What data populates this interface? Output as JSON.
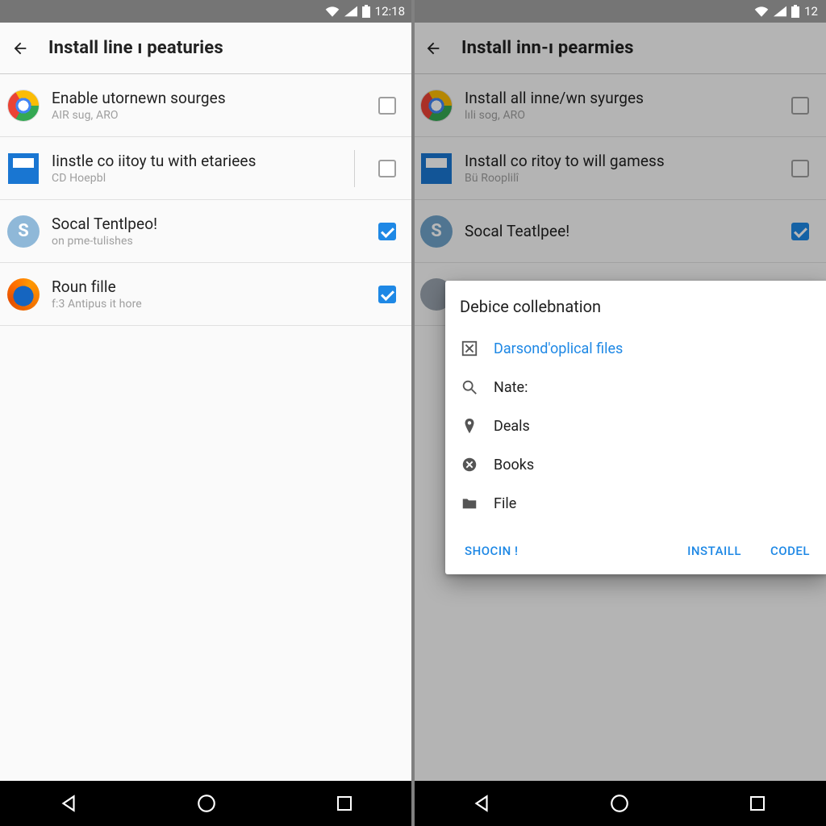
{
  "status": {
    "time": "12:18",
    "time_right_cut": "12"
  },
  "left": {
    "title": "Install line ı peaturies",
    "rows": [
      {
        "icon": "chrome-icon",
        "label": "Enable utornewn sourges",
        "sub": "AIR sug, ARO",
        "checked": false
      },
      {
        "icon": "box-icon",
        "label": "Iinstle co iitoy tu with etariees",
        "sub": "CD Hoepbl",
        "checked": false,
        "vdiv": true
      },
      {
        "icon": "skype-icon",
        "label": "Socal Tentlpeo!",
        "sub": "on pme-tulishes",
        "checked": true
      },
      {
        "icon": "firefox-icon",
        "label": "Roun fille",
        "sub": "f:3 Antipus it hore",
        "checked": true
      }
    ]
  },
  "right": {
    "title": "Install inn-ı pearmies",
    "rows": [
      {
        "icon": "chrome-icon",
        "label": "Install all inne/wn syurges",
        "sub": "lıli sog, ARO",
        "checked": false
      },
      {
        "icon": "box-icon",
        "label": "Install co ritoy to will gamess",
        "sub": "Bü Rooplilî",
        "checked": false
      },
      {
        "icon": "skype-icon",
        "label": "Socal Teatlpee!",
        "sub": "",
        "checked": true
      },
      {
        "icon": "circle-icon",
        "label": "",
        "sub": "",
        "checked": false
      }
    ],
    "dialog": {
      "title": "Debice collebnation",
      "items": [
        {
          "icon": "square-x-icon",
          "text": "Darsond'oplical files"
        },
        {
          "icon": "search-icon",
          "text": "Nate:"
        },
        {
          "icon": "pin-icon",
          "text": "Deals"
        },
        {
          "icon": "star-badge-icon",
          "text": "Books"
        },
        {
          "icon": "folder-icon",
          "text": "File"
        }
      ],
      "actions": [
        "SHOCIN !",
        "INSTAILL",
        "CODEL"
      ]
    }
  },
  "colors": {
    "accent": "#1e88e5"
  }
}
